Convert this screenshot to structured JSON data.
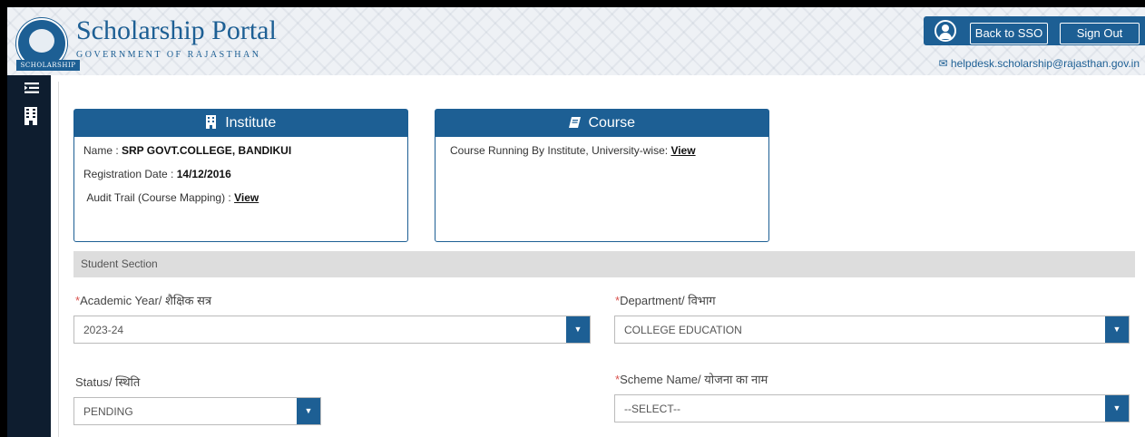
{
  "header": {
    "logo_text": "SCHOLARSHIP",
    "title": "Scholarship Portal",
    "subtitle": "GOVERNMENT OF RAJASTHAN",
    "back_label": "Back to SSO",
    "signout_label": "Sign Out",
    "email": "helpdesk.scholarship@rajasthan.gov.in"
  },
  "sidebar": {
    "icons": [
      "menu-icon",
      "building-icon"
    ]
  },
  "institute": {
    "title": "Institute",
    "name_label": "Name : ",
    "name_value": "SRP GOVT.COLLEGE, BANDIKUI",
    "reg_label": "Registration Date : ",
    "reg_value": "14/12/2016",
    "audit_label": "Audit Trail (Course Mapping) : ",
    "audit_link": "View"
  },
  "course": {
    "title": "Course",
    "text": "Course Running By Institute, University-wise: ",
    "link": "View"
  },
  "student_section": "Student Section",
  "fields": {
    "academic_year": {
      "label": "Academic Year/ शैक्षिक सत्र",
      "value": "2023-24"
    },
    "department": {
      "label": "Department/ विभाग",
      "value": "COLLEGE EDUCATION"
    },
    "status": {
      "label": "Status/ स्थिति",
      "value": "PENDING"
    },
    "scheme": {
      "label": "Scheme Name/ योजना का नाम",
      "value": "--SELECT--"
    }
  },
  "colors": {
    "primary": "#1d5f94",
    "sidebar": "#0e1d2f",
    "required": "#d9534f"
  }
}
